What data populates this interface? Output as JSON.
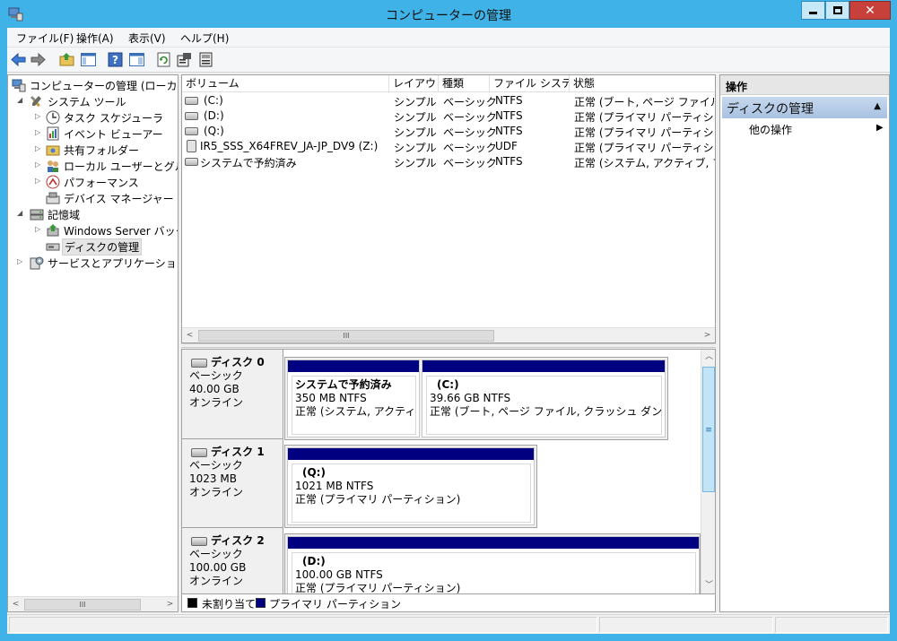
{
  "window": {
    "title": "コンピューターの管理",
    "close_glyph": "✕"
  },
  "menu": [
    "ファイル(F)",
    "操作(A)",
    "表示(V)",
    "ヘルプ(H)"
  ],
  "tree": {
    "items": [
      {
        "label": "コンピューターの管理 (ローカル)",
        "expander": "",
        "level": 0
      },
      {
        "label": "システム ツール",
        "expander": "◢",
        "level": 1
      },
      {
        "label": "タスク スケジューラ",
        "expander": "▷",
        "level": 2
      },
      {
        "label": "イベント ビューアー",
        "expander": "▷",
        "level": 2
      },
      {
        "label": "共有フォルダー",
        "expander": "▷",
        "level": 2
      },
      {
        "label": "ローカル ユーザーとグループ",
        "expander": "▷",
        "level": 2
      },
      {
        "label": "パフォーマンス",
        "expander": "▷",
        "level": 2
      },
      {
        "label": "デバイス マネージャー",
        "expander": "",
        "level": 2
      },
      {
        "label": "記憶域",
        "expander": "◢",
        "level": 1
      },
      {
        "label": "Windows Server バックアップ",
        "expander": "▷",
        "level": 2
      },
      {
        "label": "ディスクの管理",
        "expander": "",
        "level": 2,
        "selected": true
      },
      {
        "label": "サービスとアプリケーション",
        "expander": "▷",
        "level": 1
      }
    ]
  },
  "scroll": {
    "left": "<",
    "right": ">",
    "up": "︿",
    "down": "﹀",
    "grip": "III",
    "vgrip": "≡"
  },
  "volumes": {
    "columns": [
      "ボリューム",
      "レイアウト",
      "種類",
      "ファイル システム",
      "状態"
    ],
    "rows": [
      {
        "name": "(C:)",
        "layout": "シンプル",
        "type": "ベーシック",
        "fs": "NTFS",
        "status": "正常 (ブート, ページ ファイル, クラッシュ ダンプ, プライマリ パーティション)",
        "icon": "drive"
      },
      {
        "name": "(D:)",
        "layout": "シンプル",
        "type": "ベーシック",
        "fs": "NTFS",
        "status": "正常 (プライマリ パーティション)",
        "icon": "drive"
      },
      {
        "name": "(Q:)",
        "layout": "シンプル",
        "type": "ベーシック",
        "fs": "NTFS",
        "status": "正常 (プライマリ パーティション)",
        "icon": "drive"
      },
      {
        "name": "IR5_SSS_X64FREV_JA-JP_DV9 (Z:)",
        "layout": "シンプル",
        "type": "ベーシック",
        "fs": "UDF",
        "status": "正常 (プライマリ パーティション)",
        "icon": "cd"
      },
      {
        "name": "システムで予約済み",
        "layout": "シンプル",
        "type": "ベーシック",
        "fs": "NTFS",
        "status": "正常 (システム, アクティブ, プライマリ パーティション)",
        "icon": "drive"
      }
    ]
  },
  "disks": [
    {
      "name": "ディスク 0",
      "kind": "ベーシック",
      "size": "40.00 GB",
      "state": "オンライン",
      "partitions": [
        {
          "name": "システムで予約済み",
          "size": "350 MB NTFS",
          "status": "正常 (システム, アクティブ, プライマリ パーティション)"
        },
        {
          "name": "(C:)",
          "size": "39.66 GB NTFS",
          "status": "正常 (ブート, ページ ファイル, クラッシュ ダンプ, プライマリ パーティション)"
        }
      ]
    },
    {
      "name": "ディスク 1",
      "kind": "ベーシック",
      "size": "1023 MB",
      "state": "オンライン",
      "partitions": [
        {
          "name": "(Q:)",
          "size": "1021 MB NTFS",
          "status": "正常 (プライマリ パーティション)"
        }
      ]
    },
    {
      "name": "ディスク 2",
      "kind": "ベーシック",
      "size": "100.00 GB",
      "state": "オンライン",
      "partitions": [
        {
          "name": "(D:)",
          "size": "100.00 GB NTFS",
          "status": "正常 (プライマリ パーティション)"
        }
      ]
    }
  ],
  "legend": {
    "unallocated": "未割り当て",
    "primary": "プライマリ パーティション",
    "unallocated_color": "#000000",
    "primary_color": "#000080"
  },
  "actions": {
    "header": "操作",
    "section": "ディスクの管理",
    "collapse_glyph": "▲",
    "item": "他の操作",
    "item_arrow": "▶"
  },
  "colors": {
    "titlebar": "#3fb3e8",
    "partition_bar": "#000080",
    "selection": "#e5e5e5",
    "close_button": "#c7403a"
  }
}
